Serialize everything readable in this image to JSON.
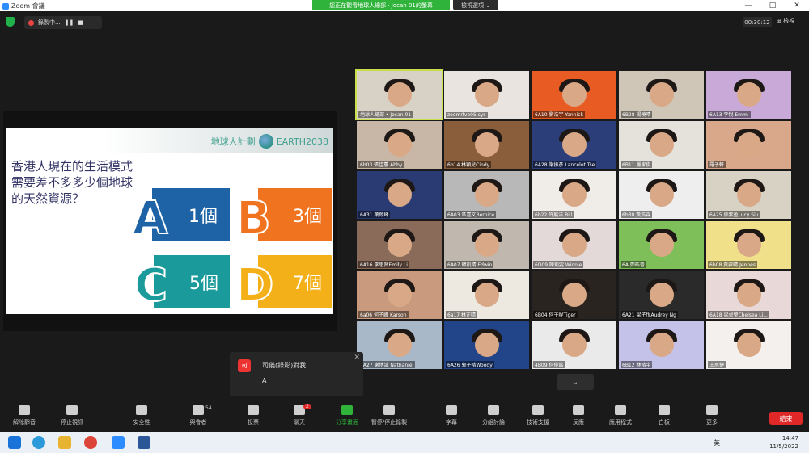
{
  "window": {
    "title": "Zoom 會議",
    "minimize": "—",
    "maximize": "□",
    "close": "✕"
  },
  "share_banner": "您正在觀看地球人總部 · Jocan 01的螢幕",
  "view_options": "檢視選項 ⌄",
  "recording": {
    "label": "錄製中...",
    "pause": "❚❚",
    "stop": "■"
  },
  "timer": "00:30:12",
  "gallery_view": "⊞ 檢視",
  "slide": {
    "brand_cn": "地球人計劃",
    "brand_en": "EARTH2038",
    "question": "香港人現在的生活模式需要差不多多少個地球的天然資源？",
    "options": [
      {
        "letter": "A",
        "text": "1個",
        "color": "#1e63a6"
      },
      {
        "letter": "B",
        "text": "3個",
        "color": "#f0731f"
      },
      {
        "letter": "C",
        "text": "5個",
        "color": "#1a9a9a"
      },
      {
        "letter": "D",
        "text": "7個",
        "color": "#f3b019"
      }
    ]
  },
  "participants": [
    "地球人總部 • Jocan 01",
    "zoomrfve05 sys",
    "6A10 劉浩宇 Yannick",
    "6B28 楊曉晴",
    "6A13 李悅 Emmi",
    "6b03 張佳蕙 Abby",
    "6b14 林穎兒Cindy",
    "6A28 謝振彥 Lancelot Tse",
    "6B11 嚴家俊",
    "羅子軒",
    "6A31 葉朗峰",
    "6A03 區嘉文Bernice",
    "6b22 許展洋 Bill",
    "6b30 黃浩霖",
    "6A25 鄧紫盈Lucy Siu",
    "6A16 李思賢Emily Li",
    "6A07 韓凱晴 Edwin",
    "6D09 陳莉雯 Winnie",
    "6A 鄭皓晉",
    "6b08 黃啟晴 Jennes",
    "6a06 何子峰 Karson",
    "6a17 林芷晴",
    "6B04 何子程Tiger",
    "6A21 梁子悅Audrey Ng",
    "6A18 梁卓瑩Chelsea Li...",
    "6A27 謝博濤 Nathaniel",
    "6A26 郭子晴Woody",
    "4B09 何俊銘",
    "6B12 林晴宇",
    "王思捷"
  ],
  "chat": {
    "avatar": "司",
    "name": "司儀(錄影)對我",
    "message": "A",
    "close": "✕"
  },
  "toolbar": [
    {
      "label": "解除靜音"
    },
    {
      "label": "停止視訊"
    },
    {
      "label": "安全性"
    },
    {
      "label": "與會者",
      "count": "54"
    },
    {
      "label": "投票"
    },
    {
      "label": "聊天",
      "badge": "2"
    },
    {
      "label": "分享畫面"
    },
    {
      "label": "暫停/停止錄製"
    },
    {
      "label": "字幕"
    },
    {
      "label": "分組討論"
    },
    {
      "label": "技術支援"
    },
    {
      "label": "反應"
    },
    {
      "label": "應用程式"
    },
    {
      "label": "白板"
    },
    {
      "label": "更多"
    }
  ],
  "end_button": "結束",
  "clock": {
    "time": "14:47",
    "date": "11/5/2022"
  },
  "input_lang": "英"
}
